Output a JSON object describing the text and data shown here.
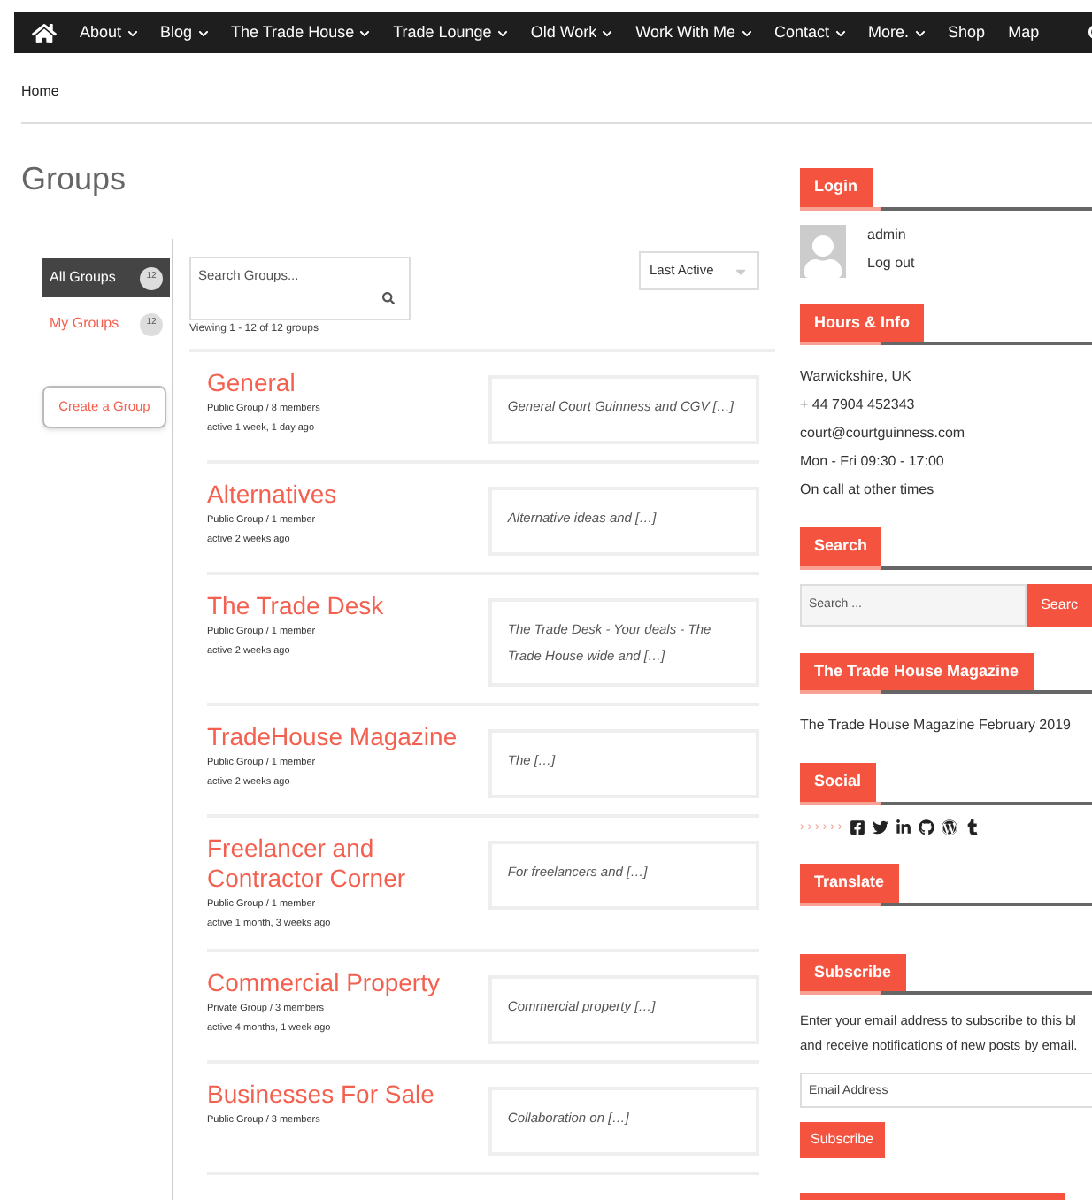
{
  "nav": {
    "items": [
      {
        "label": "About",
        "dropdown": true
      },
      {
        "label": "Blog",
        "dropdown": true
      },
      {
        "label": "The Trade House",
        "dropdown": true
      },
      {
        "label": "Trade Lounge",
        "dropdown": true
      },
      {
        "label": "Old Work",
        "dropdown": true
      },
      {
        "label": "Work With Me",
        "dropdown": true
      },
      {
        "label": "Contact",
        "dropdown": true
      },
      {
        "label": "More.",
        "dropdown": true
      },
      {
        "label": "Shop",
        "dropdown": false
      },
      {
        "label": "Map",
        "dropdown": false
      }
    ]
  },
  "breadcrumb": "Home",
  "page_title": "Groups",
  "group_tabs": [
    {
      "label": "All Groups",
      "count": "12",
      "selected": true
    },
    {
      "label": "My Groups",
      "count": "12",
      "selected": false
    }
  ],
  "create_button": "Create a Group",
  "group_search": {
    "placeholder": "Search Groups..."
  },
  "sort": {
    "value": "Last Active"
  },
  "viewing": "Viewing 1 - 12 of 12 groups",
  "groups": [
    {
      "name": "General",
      "meta": "Public Group / 8 members",
      "active": "active 1 week, 1 day ago",
      "description": "General Court Guinness and CGV […]"
    },
    {
      "name": "Alternatives",
      "meta": "Public Group / 1 member",
      "active": "active 2 weeks ago",
      "description": "Alternative ideas and […]"
    },
    {
      "name": "The Trade Desk",
      "meta": "Public Group / 1 member",
      "active": "active 2 weeks ago",
      "description": "The Trade Desk - Your deals - The Trade House wide and […]"
    },
    {
      "name": "TradeHouse Magazine",
      "meta": "Public Group / 1 member",
      "active": "active 2 weeks ago",
      "description": "The […]"
    },
    {
      "name": "Freelancer and Contractor Corner",
      "meta": "Public Group / 1 member",
      "active": "active 1 month, 3 weeks ago",
      "description": "For freelancers and […]"
    },
    {
      "name": "Commercial Property",
      "meta": "Private Group / 3 members",
      "active": "active 4 months, 1 week ago",
      "description": "Commercial property […]"
    },
    {
      "name": "Businesses For Sale",
      "meta": "Public Group / 3 members",
      "description": "Collaboration on […]"
    }
  ],
  "widgets": [
    {
      "kind": "login",
      "title": "Login",
      "user": "admin",
      "link": "Log out"
    },
    {
      "kind": "lines",
      "title": "Hours & Info",
      "lines": [
        "Warwickshire, UK",
        "+ 44 7904 452343",
        "court@courtguinness.com",
        "Mon - Fri 09:30 - 17:00",
        "On call at other times"
      ]
    },
    {
      "kind": "search",
      "title": "Search",
      "placeholder": "Search ...",
      "button": "Searc"
    },
    {
      "kind": "lines",
      "title": "The Trade House Magazine",
      "lines": [
        "The Trade House Magazine February 2019"
      ]
    },
    {
      "kind": "social",
      "title": "Social",
      "arrows": "› › › › › ›"
    },
    {
      "kind": "empty",
      "title": "Translate"
    },
    {
      "kind": "subscribe",
      "title": "Subscribe",
      "text": "Enter your email address to subscribe to this bl and receive notifications of new posts by email.",
      "placeholder": "Email Address",
      "button": "Subscribe"
    },
    {
      "kind": "cut"
    }
  ]
}
